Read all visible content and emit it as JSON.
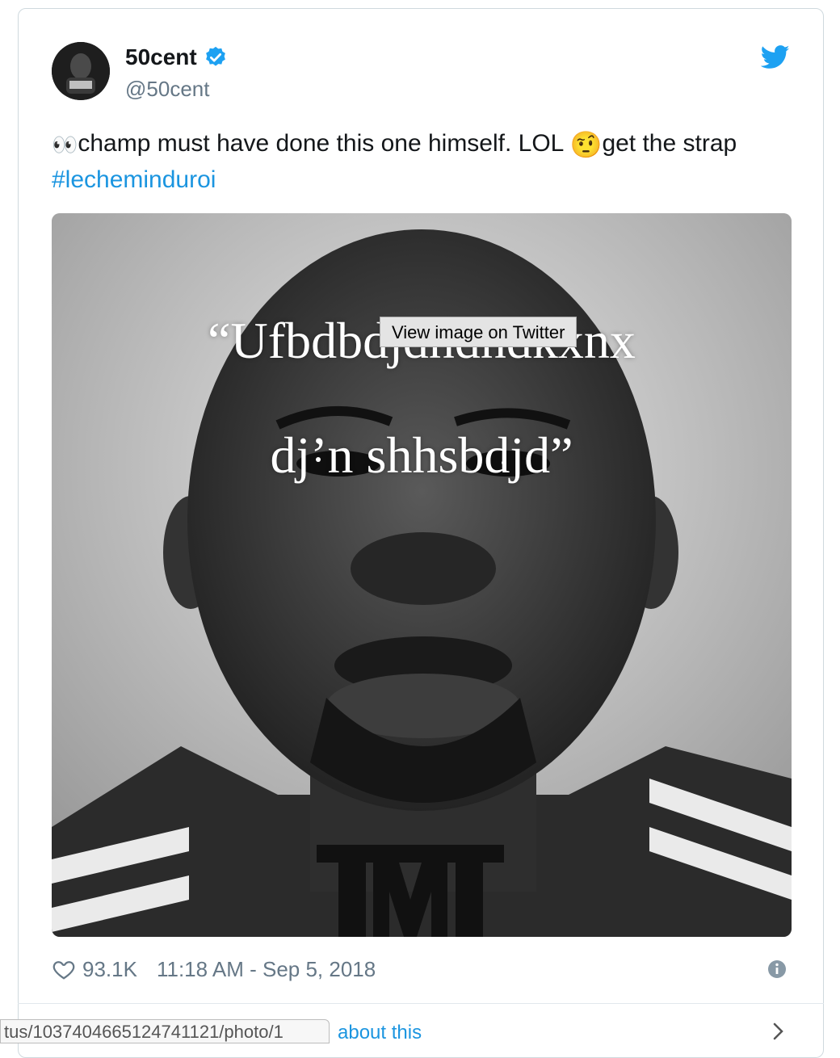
{
  "tweet": {
    "display_name": "50cent",
    "handle": "@50cent",
    "verified": true,
    "text_emoji_eyes": "👀",
    "text_part_1": "champ must have done this one himself. LOL ",
    "text_emoji_face": "🤨",
    "text_part_2": "get the strap ",
    "hashtag": "#lecheminduroi"
  },
  "media": {
    "tooltip": "View image on Twitter",
    "quote_line_1": "“Ufbdbdjdndndkxnx",
    "quote_line_2": "dj’n shhsbdjd”",
    "logo_text": "TMT"
  },
  "footer": {
    "likes": "93.1K",
    "timestamp": "11:18 AM - Sep 5, 2018"
  },
  "below": {
    "status_url": "tus/1037404665124741121/photo/1",
    "about_link": "about this"
  },
  "colors": {
    "link": "#1b95e0",
    "verified": "#1da1f2",
    "muted": "#657786"
  },
  "icons": [
    "twitter-bird-icon",
    "verified-badge-icon",
    "heart-icon",
    "info-icon",
    "chevron-right-icon"
  ]
}
